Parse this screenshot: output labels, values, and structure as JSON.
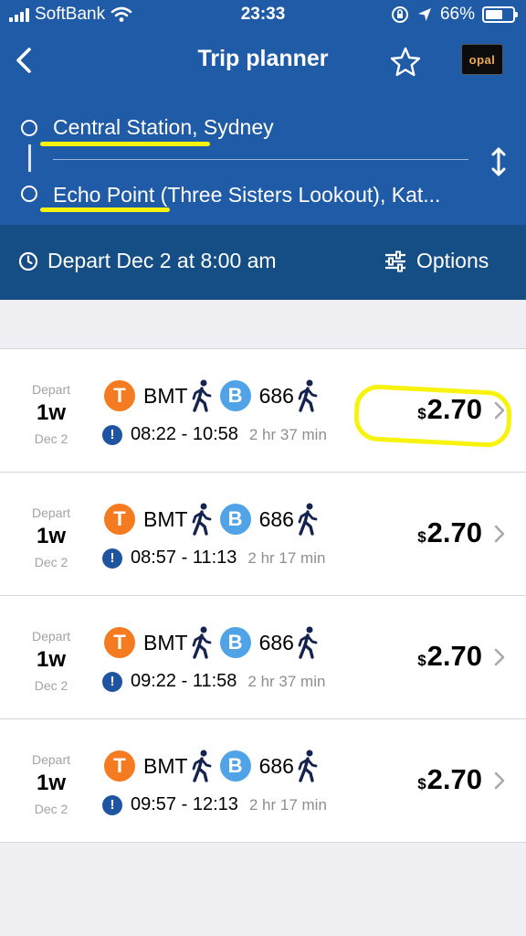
{
  "status_bar": {
    "carrier": "SoftBank",
    "time": "23:33",
    "battery_text": "66%",
    "battery_level": 0.66
  },
  "nav": {
    "title": "Trip planner",
    "opal_label": "opal"
  },
  "route": {
    "origin_highlight": "Central Station",
    "origin_rest": ", Sydney",
    "destination_highlight": "Echo Point",
    "destination_rest": " (Three Sisters Lookout), Kat..."
  },
  "depart_bar": {
    "depart_text": "Depart Dec 2 at 8:00 am",
    "options_label": "Options"
  },
  "trips": [
    {
      "depart_label": "Depart",
      "when": "1w",
      "date": "Dec 2",
      "train_badge": "T",
      "train_line": "BMT",
      "bus_badge": "B",
      "bus_route": "686",
      "alert_icon": "!",
      "time_range": "08:22 - 10:58",
      "duration": "2 hr 37 min",
      "currency": "$",
      "price": "2.70"
    },
    {
      "depart_label": "Depart",
      "when": "1w",
      "date": "Dec 2",
      "train_badge": "T",
      "train_line": "BMT",
      "bus_badge": "B",
      "bus_route": "686",
      "alert_icon": "!",
      "time_range": "08:57 - 11:13",
      "duration": "2 hr 17 min",
      "currency": "$",
      "price": "2.70"
    },
    {
      "depart_label": "Depart",
      "when": "1w",
      "date": "Dec 2",
      "train_badge": "T",
      "train_line": "BMT",
      "bus_badge": "B",
      "bus_route": "686",
      "alert_icon": "!",
      "time_range": "09:22 - 11:58",
      "duration": "2 hr 37 min",
      "currency": "$",
      "price": "2.70"
    },
    {
      "depart_label": "Depart",
      "when": "1w",
      "date": "Dec 2",
      "train_badge": "T",
      "train_line": "BMT",
      "bus_badge": "B",
      "bus_route": "686",
      "alert_icon": "!",
      "time_range": "09:57 - 12:13",
      "duration": "2 hr 17 min",
      "currency": "$",
      "price": "2.70"
    }
  ],
  "icons": {
    "back": "chevron-left-icon",
    "favorite": "star-icon",
    "swap": "swap-vertical-icon",
    "clock": "clock-icon",
    "options": "sliders-icon",
    "walk": "walk-icon",
    "alert": "alert-icon",
    "disclosure": "chevron-right-icon"
  },
  "colors": {
    "header": "#1f5ba7",
    "depart_bar": "#154e85",
    "background": "#efeff4",
    "train": "#f47b20",
    "bus": "#4fa3e6",
    "alert": "#1f55a0",
    "highlight": "#f7f30f",
    "walk": "#14234f"
  }
}
